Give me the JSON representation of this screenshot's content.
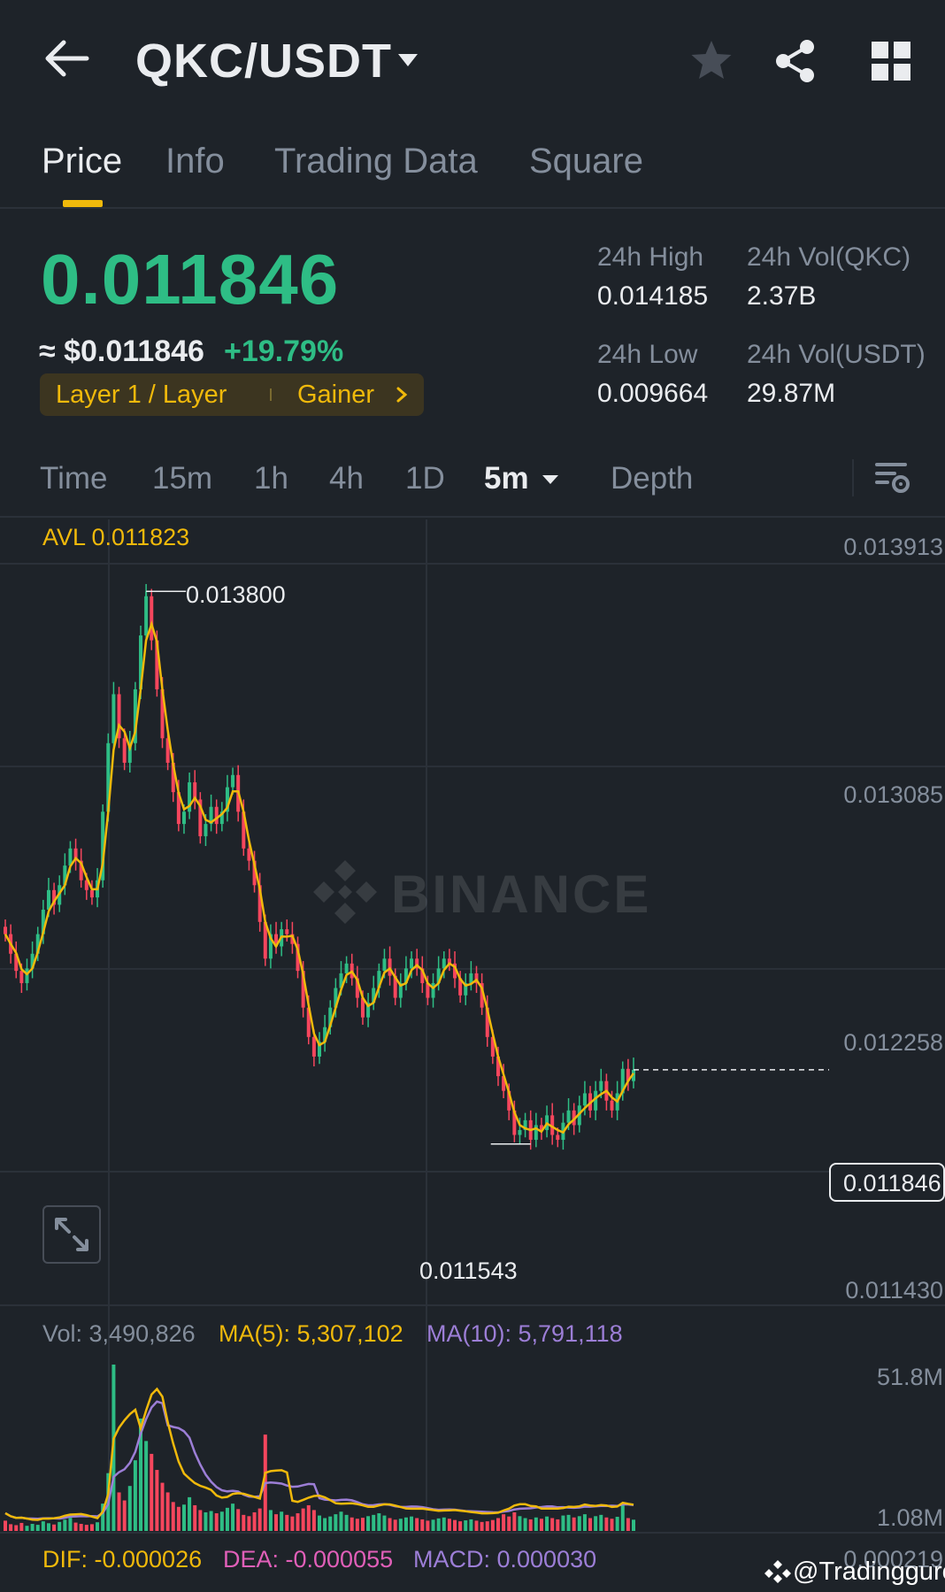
{
  "header": {
    "pair": "QKC/USDT"
  },
  "tabs": [
    {
      "label": "Price",
      "active": true
    },
    {
      "label": "Info",
      "active": false
    },
    {
      "label": "Trading Data",
      "active": false
    },
    {
      "label": "Square",
      "active": false
    }
  ],
  "ticker": {
    "last_price": "0.011846",
    "fiat_price": "≈ $0.011846",
    "change_pct": "+19.79%",
    "tag_category": "Layer 1 / Layer",
    "tag_badge": "Gainer",
    "high_label": "24h High",
    "high_value": "0.014185",
    "low_label": "24h Low",
    "low_value": "0.009664",
    "vol_base_label": "24h Vol(QKC)",
    "vol_base_value": "2.37B",
    "vol_quote_label": "24h Vol(USDT)",
    "vol_quote_value": "29.87M"
  },
  "intervals": {
    "time": "Time",
    "m15": "15m",
    "h1": "1h",
    "h4": "4h",
    "d1": "1D",
    "selected": "5m",
    "depth": "Depth"
  },
  "chart_overlay": {
    "avl": "AVL 0.011823",
    "price_axis": [
      "0.013913",
      "0.013085",
      "0.012258",
      "0.011430"
    ],
    "high_marker": "0.013800",
    "low_marker": "0.011543",
    "last_marker": "0.011846",
    "watermark": "BINANCE"
  },
  "volume": {
    "vol": "Vol: 3,490,826",
    "ma5": "MA(5): 5,307,102",
    "ma10": "MA(10): 5,791,118",
    "axis_top": "51.8M",
    "axis_bottom": "1.08M"
  },
  "macd": {
    "dif": "DIF: -0.000026",
    "dea": "DEA: -0.000055",
    "macd": "MACD: 0.000030",
    "axis": "0.000219"
  },
  "credit": "@Tradingguro",
  "colors": {
    "background": "#1e2329",
    "up": "#2ebd85",
    "down": "#f6465d",
    "accent": "#f0b90b",
    "ma10": "#9c7ed6",
    "text_secondary": "#848e9c"
  },
  "chart_data": {
    "type": "candlestick",
    "interval": "5m",
    "ylim": [
      0.01143,
      0.013913
    ],
    "y_ticks": [
      0.013913,
      0.013085,
      0.012258,
      0.01143
    ],
    "high": 0.0138,
    "low": 0.011543,
    "last": 0.011846,
    "avl": 0.011823,
    "close_series": [
      0.0124,
      0.01232,
      0.01225,
      0.0122,
      0.01226,
      0.01232,
      0.0124,
      0.0125,
      0.01258,
      0.01252,
      0.0126,
      0.01268,
      0.01275,
      0.0127,
      0.01262,
      0.01258,
      0.01255,
      0.01262,
      0.0129,
      0.01318,
      0.01338,
      0.0132,
      0.0131,
      0.01318,
      0.0134,
      0.01362,
      0.01378,
      0.0136,
      0.0134,
      0.0132,
      0.0131,
      0.01298,
      0.01285,
      0.0129,
      0.01302,
      0.01295,
      0.0128,
      0.01285,
      0.01292,
      0.01285,
      0.0129,
      0.013,
      0.01305,
      0.0129,
      0.01275,
      0.0127,
      0.0126,
      0.01245,
      0.0123,
      0.0124,
      0.01235,
      0.01242,
      0.0124,
      0.01236,
      0.01225,
      0.0121,
      0.01198,
      0.0119,
      0.01196,
      0.01202,
      0.0121,
      0.01218,
      0.01224,
      0.01228,
      0.01222,
      0.01214,
      0.01206,
      0.01212,
      0.01218,
      0.01225,
      0.0123,
      0.01223,
      0.01214,
      0.0122,
      0.01226,
      0.0123,
      0.01226,
      0.0122,
      0.01214,
      0.0122,
      0.01226,
      0.0123,
      0.01228,
      0.01222,
      0.01215,
      0.0122,
      0.01224,
      0.0122,
      0.0121,
      0.01198,
      0.0119,
      0.01182,
      0.01176,
      0.01168,
      0.01158,
      0.0116,
      0.01164,
      0.01156,
      0.01162,
      0.0116,
      0.01166,
      0.01158,
      0.01156,
      0.01163,
      0.01168,
      0.01162,
      0.0117,
      0.01175,
      0.01168,
      0.01176,
      0.0118,
      0.01172,
      0.01168,
      0.01175,
      0.01185,
      0.0118,
      0.011846
    ],
    "volume_series": [
      3.2,
      2.1,
      1.8,
      2.5,
      1.6,
      2.2,
      1.9,
      3.0,
      2.4,
      2.0,
      2.8,
      3.5,
      4.1,
      2.6,
      2.2,
      1.9,
      2.1,
      2.7,
      8.5,
      18.0,
      51.8,
      12.0,
      9.5,
      14.0,
      22.0,
      35.0,
      28.0,
      24.0,
      19.0,
      15.0,
      12.0,
      9.0,
      7.5,
      8.2,
      10.5,
      8.0,
      6.5,
      5.8,
      6.2,
      5.5,
      6.0,
      7.2,
      8.5,
      6.8,
      5.0,
      4.6,
      5.8,
      7.0,
      30.0,
      6.5,
      5.2,
      6.0,
      5.0,
      4.5,
      5.5,
      7.0,
      8.0,
      6.5,
      4.8,
      4.0,
      4.5,
      5.2,
      6.0,
      5.0,
      4.2,
      3.8,
      4.1,
      4.6,
      5.0,
      5.5,
      4.8,
      4.0,
      3.5,
      3.8,
      4.2,
      4.5,
      4.0,
      3.6,
      3.2,
      3.5,
      3.9,
      4.2,
      3.8,
      3.4,
      3.0,
      3.3,
      3.6,
      3.2,
      2.8,
      3.0,
      3.4,
      4.0,
      5.2,
      4.5,
      5.8,
      4.6,
      4.0,
      3.6,
      4.2,
      3.8,
      4.5,
      4.0,
      3.6,
      4.8,
      5.0,
      4.2,
      4.6,
      5.2,
      4.0,
      4.6,
      5.0,
      4.2,
      3.8,
      4.4,
      8.0,
      4.0,
      3.5
    ]
  }
}
